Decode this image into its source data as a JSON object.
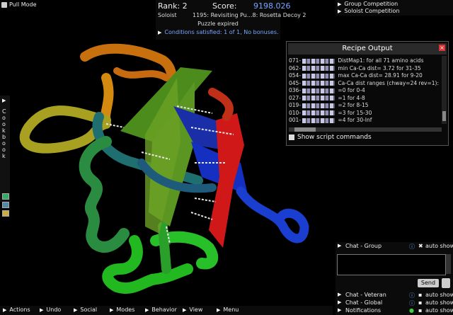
{
  "toolbar": {
    "pull_mode": "Pull Mode"
  },
  "score_panel": {
    "rank": "Rank: 2",
    "score_label": "Score:",
    "score_value": "9198.026",
    "mode": "Soloist",
    "puzzle": "1195: Revisiting Pu...8: Rosetta Decoy 2",
    "status": "Puzzle expired",
    "conditions": "Conditions satisfied: 1 of 1, No bonuses."
  },
  "competition": {
    "group": "Group Competition",
    "soloist": "Soloist Competition"
  },
  "recipe_output": {
    "title": "Recipe Output",
    "close_icon": "close-icon",
    "lines": [
      {
        "prefix": "071",
        "text": "DistMap1: for all 71 amino acids"
      },
      {
        "prefix": "062",
        "text": "min Ca-Ca dist=  3.72 for  31-35"
      },
      {
        "prefix": "054",
        "text": "max Ca-Ca dist= 28.91 for   9-20"
      },
      {
        "prefix": "045",
        "text": "Ca-Ca dist ranges (chway=24 rev=1):"
      },
      {
        "prefix": "036",
        "text": "=0 for  0-4"
      },
      {
        "prefix": "027",
        "text": "=1 for  4-8"
      },
      {
        "prefix": "019",
        "text": "=2 for  8-15"
      },
      {
        "prefix": "010",
        "text": "=3 for 15-30"
      },
      {
        "prefix": "001",
        "text": "=4 for 30-Inf"
      }
    ],
    "show_script": "Show script commands"
  },
  "cookbook": {
    "label": "Cookbook"
  },
  "chat": {
    "group": "Chat - Group",
    "veteran": "Chat - Veteran",
    "global": "Chat - Global",
    "notifications": "Notifications",
    "auto_show": "auto show",
    "send": "Send"
  },
  "bottom_menu": {
    "actions": "Actions",
    "undo": "Undo",
    "social": "Social",
    "modes": "Modes",
    "behavior": "Behavior",
    "view": "View",
    "menu": "Menu"
  },
  "colors": {
    "accent": "#7aa6ff",
    "panel_bg": "#0b0b0b",
    "close": "#dd3333"
  }
}
